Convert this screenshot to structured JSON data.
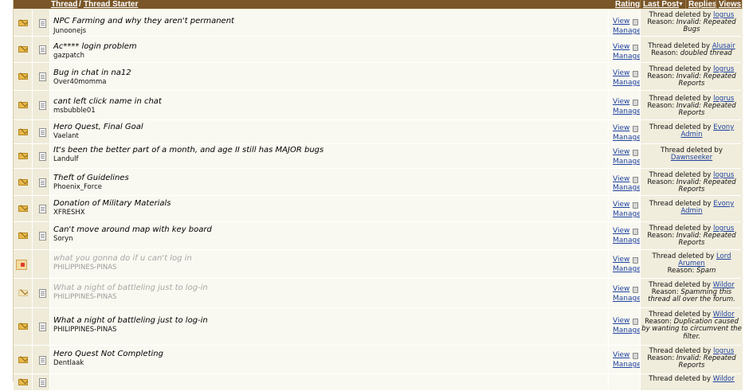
{
  "header": {
    "thread": "Thread",
    "slash": "/",
    "thread_starter": "Thread Starter",
    "rating": "Rating",
    "last_post": "Last Post",
    "sort_arrow": "▼",
    "replies": "Replies",
    "views": "Views"
  },
  "colors": {
    "header_bg": "#7a5628",
    "link": "#1f43a0",
    "row_bg": "#faf9f1"
  },
  "actions": {
    "view": "View",
    "manage": "Manage"
  },
  "threads": [
    {
      "title": "NPC Farming and why they aren't permanent",
      "starter": "Junoonejs",
      "status_icon": "envelope-icon",
      "faded": false,
      "deleted_prefix": "Thread deleted by ",
      "deleted_by": "logrus",
      "reason_label": "Reason: ",
      "reason": "Invalid: Repeated Bugs"
    },
    {
      "title": "Ac**** login problem",
      "starter": "gazpatch",
      "status_icon": "envelope-icon",
      "faded": false,
      "deleted_prefix": "Thread deleted by ",
      "deleted_by": "Alusair",
      "reason_label": "Reason: ",
      "reason": "doubled thread"
    },
    {
      "title": "Bug in chat in na12",
      "starter": "Over40momma",
      "status_icon": "envelope-icon",
      "faded": false,
      "deleted_prefix": "Thread deleted by ",
      "deleted_by": "logrus",
      "reason_label": "Reason: ",
      "reason": "Invalid: Repeated Reports"
    },
    {
      "title": "cant left click name in chat",
      "starter": "msbubble01",
      "status_icon": "envelope-icon",
      "faded": false,
      "deleted_prefix": "Thread deleted by ",
      "deleted_by": "logrus",
      "reason_label": "Reason: ",
      "reason": "Invalid: Repeated Reports"
    },
    {
      "title": "Hero Quest, Final Goal",
      "starter": "Vaelant",
      "status_icon": "envelope-icon",
      "faded": false,
      "deleted_prefix": "Thread deleted by ",
      "deleted_by": "Evony Admin",
      "reason_label": "",
      "reason": ""
    },
    {
      "title": "It's been the better part of a month, and age II still has MAJOR bugs",
      "starter": "Landulf",
      "status_icon": "envelope-icon",
      "faded": false,
      "deleted_prefix": "Thread deleted by ",
      "deleted_by": "Dawnseeker",
      "reason_label": "",
      "reason": ""
    },
    {
      "title": "Theft of Guidelines",
      "starter": "Phoenix_Force",
      "status_icon": "envelope-icon",
      "faded": false,
      "deleted_prefix": "Thread deleted by ",
      "deleted_by": "logrus",
      "reason_label": "Reason: ",
      "reason": "Invalid: Repeated Reports"
    },
    {
      "title": "Donation of Military Materials",
      "starter": "XFRESHX",
      "status_icon": "envelope-icon",
      "faded": false,
      "deleted_prefix": "Thread deleted by ",
      "deleted_by": "Evony Admin",
      "reason_label": "",
      "reason": ""
    },
    {
      "title": "Can't move around map with key board",
      "starter": "Soryn",
      "status_icon": "envelope-icon",
      "faded": false,
      "deleted_prefix": "Thread deleted by ",
      "deleted_by": "logrus",
      "reason_label": "Reason: ",
      "reason": "Invalid: Repeated Reports"
    },
    {
      "title": "what you gonna do if u can't log in",
      "starter": "PHILIPPINES-PINAS",
      "status_icon": "locked-folder-icon",
      "faded": true,
      "deleted_prefix": "Thread deleted by ",
      "deleted_by": "Lord Arumen",
      "reason_label": "Reason: ",
      "reason": "Spam"
    },
    {
      "title": "What a night of battleling just to log-in",
      "starter": "PHILIPPINES-PINAS",
      "status_icon": "envelope-icon",
      "faded": true,
      "deleted_prefix": "Thread deleted by ",
      "deleted_by": "Wildor",
      "reason_label": "Reason: ",
      "reason": "Spamming this thread all over the forum."
    },
    {
      "title": "What a night of battleling just to log-in",
      "starter": "PHILIPPINES-PINAS",
      "status_icon": "envelope-icon",
      "faded": false,
      "deleted_prefix": "Thread deleted by ",
      "deleted_by": "Wildor",
      "reason_label": "Reason: ",
      "reason": "Duplication caused by wanting to circumvent the filter."
    },
    {
      "title": "Hero Quest Not Completing",
      "starter": "Dentlaak",
      "status_icon": "envelope-icon",
      "faded": false,
      "deleted_prefix": "Thread deleted by ",
      "deleted_by": "logrus",
      "reason_label": "Reason: ",
      "reason": "Invalid: Repeated Reports"
    },
    {
      "title": "",
      "starter": "",
      "status_icon": "envelope-icon",
      "faded": false,
      "deleted_prefix": "Thread deleted by ",
      "deleted_by": "Wildor",
      "reason_label": "",
      "reason": ""
    }
  ]
}
